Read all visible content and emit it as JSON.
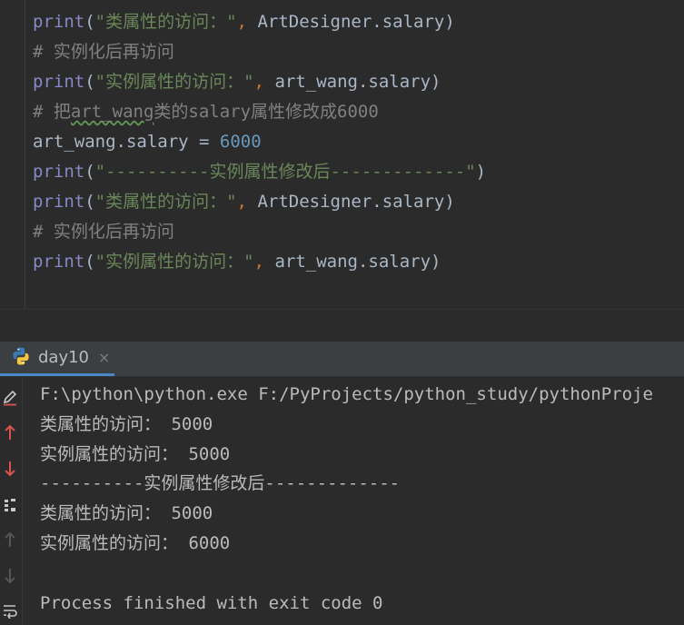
{
  "editor": {
    "lines": [
      {
        "type": "print",
        "fn": "print",
        "open": "(",
        "str": "\"类属性的访问：\"",
        "comma": ",",
        "arg": " ArtDesigner.salary",
        "close": ")"
      },
      {
        "type": "comment",
        "text": "# 实例化后再访问"
      },
      {
        "type": "print",
        "fn": "print",
        "open": "(",
        "str": "\"实例属性的访问：\"",
        "comma": ",",
        "arg": " art_wang.salary",
        "close": ")"
      },
      {
        "type": "comment2",
        "pre": "# 把",
        "mid": "art_wang",
        "post": "类的salary属性修改成6000"
      },
      {
        "type": "assign",
        "lhs": "art_wang.salary = ",
        "num": "6000"
      },
      {
        "type": "print1",
        "fn": "print",
        "open": "(",
        "str": "\"----------实例属性修改后-------------\"",
        "close": ")"
      },
      {
        "type": "print",
        "fn": "print",
        "open": "(",
        "str": "\"类属性的访问：\"",
        "comma": ",",
        "arg": " ArtDesigner.salary",
        "close": ")"
      },
      {
        "type": "comment",
        "text": "# 实例化后再访问"
      },
      {
        "type": "print",
        "fn": "print",
        "open": "(",
        "str": "\"实例属性的访问：\"",
        "comma": ",",
        "arg": " art_wang.salary",
        "close": ")"
      }
    ]
  },
  "run": {
    "tab_title": "day10",
    "close_glyph": "×",
    "icons": [
      "edit-icon",
      "arrow-up-icon",
      "arrow-down-icon",
      "layout-icon",
      "arrow-up-disabled-icon",
      "arrow-down-disabled-icon",
      "soft-wrap-icon"
    ]
  },
  "console": {
    "lines": [
      "F:\\python\\python.exe F:/PyProjects/python_study/pythonProje",
      "类属性的访问： 5000",
      "实例属性的访问： 5000",
      "----------实例属性修改后-------------",
      "类属性的访问： 5000",
      "实例属性的访问： 6000",
      "",
      "Process finished with exit code 0"
    ]
  },
  "colors": {
    "background": "#2b2b2b",
    "keyword_fn": "#8888c6",
    "string": "#6a8759",
    "comment": "#808080",
    "number": "#6897bb",
    "punct": "#cc7832",
    "error_red": "#c75450"
  }
}
